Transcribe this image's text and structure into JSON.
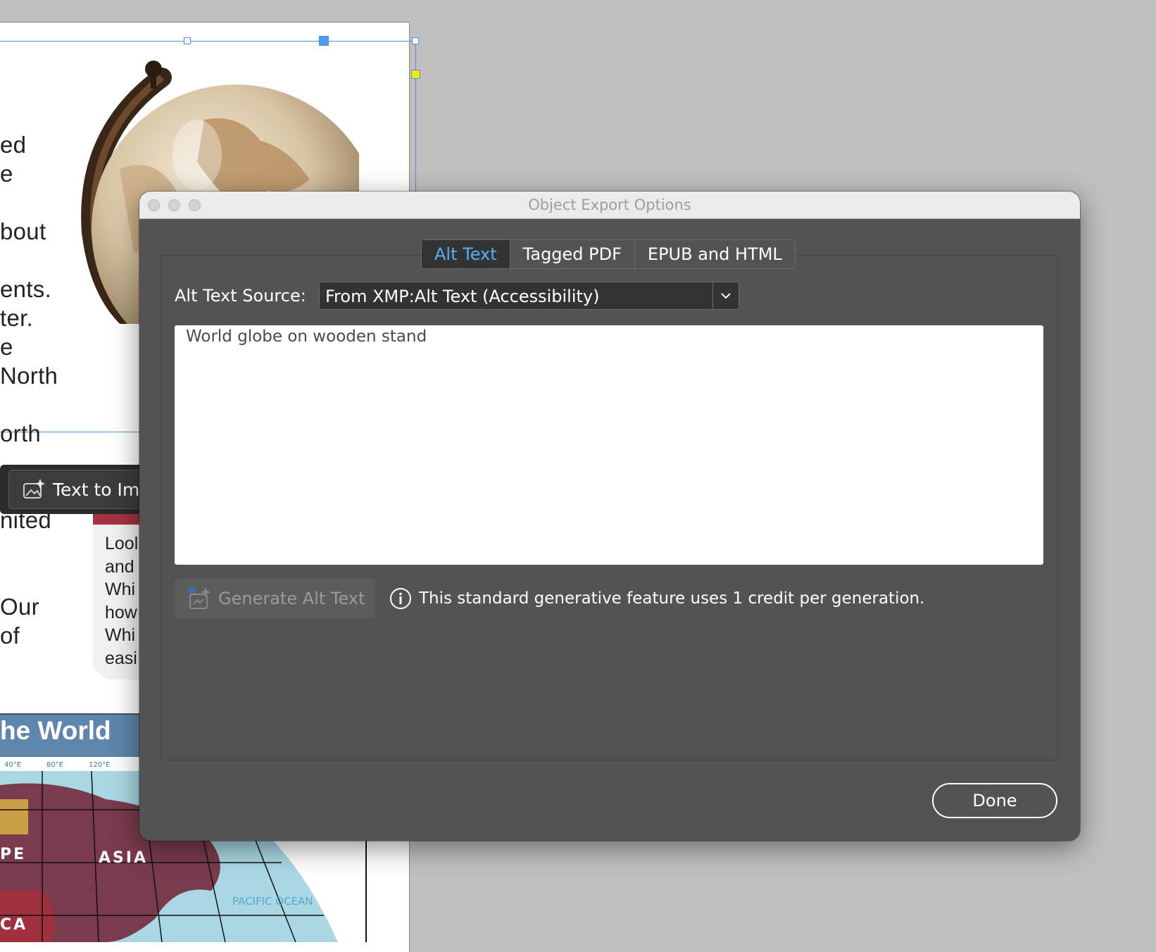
{
  "document": {
    "fragments": [
      "ed",
      "e",
      "bout",
      "ents.",
      "ter.",
      "e",
      "North",
      "orth",
      "nited",
      "Our",
      "of"
    ],
    "sidebar_lines": [
      "Lool",
      "and",
      "Whi",
      "how",
      "Whi",
      "easi"
    ],
    "world_title": "he World",
    "map_labels": {
      "degrees": [
        "40°E",
        "80°E",
        "120°E"
      ],
      "asia": "ASIA",
      "europe": "PE",
      "africa": "CA",
      "pacific": "PACIFIC OCEAN"
    },
    "text_to_image_label": "Text to Ima"
  },
  "dialog": {
    "title": "Object Export Options",
    "tabs": [
      {
        "label": "Alt Text",
        "active": true
      },
      {
        "label": "Tagged PDF",
        "active": false
      },
      {
        "label": "EPUB and HTML",
        "active": false
      }
    ],
    "alt_text_source_label": "Alt Text Source:",
    "alt_text_source_value": "From XMP:Alt Text (Accessibility)",
    "alt_text": "World globe on wooden stand",
    "generate_label": "Generate Alt Text",
    "info_text": "This standard generative feature uses 1 credit per generation.",
    "done_label": "Done"
  },
  "colors": {
    "active_tab": "#59aef5",
    "dialog_bg": "#535353",
    "canvas_bg": "#c0c0c0",
    "banner": "#5f86ad",
    "map_land": "#7a3b4c",
    "map_ocean": "#a9d8e4"
  },
  "icons": [
    "generate-image-icon",
    "generate-alt-text-icon",
    "info-icon",
    "chevron-down-icon"
  ]
}
